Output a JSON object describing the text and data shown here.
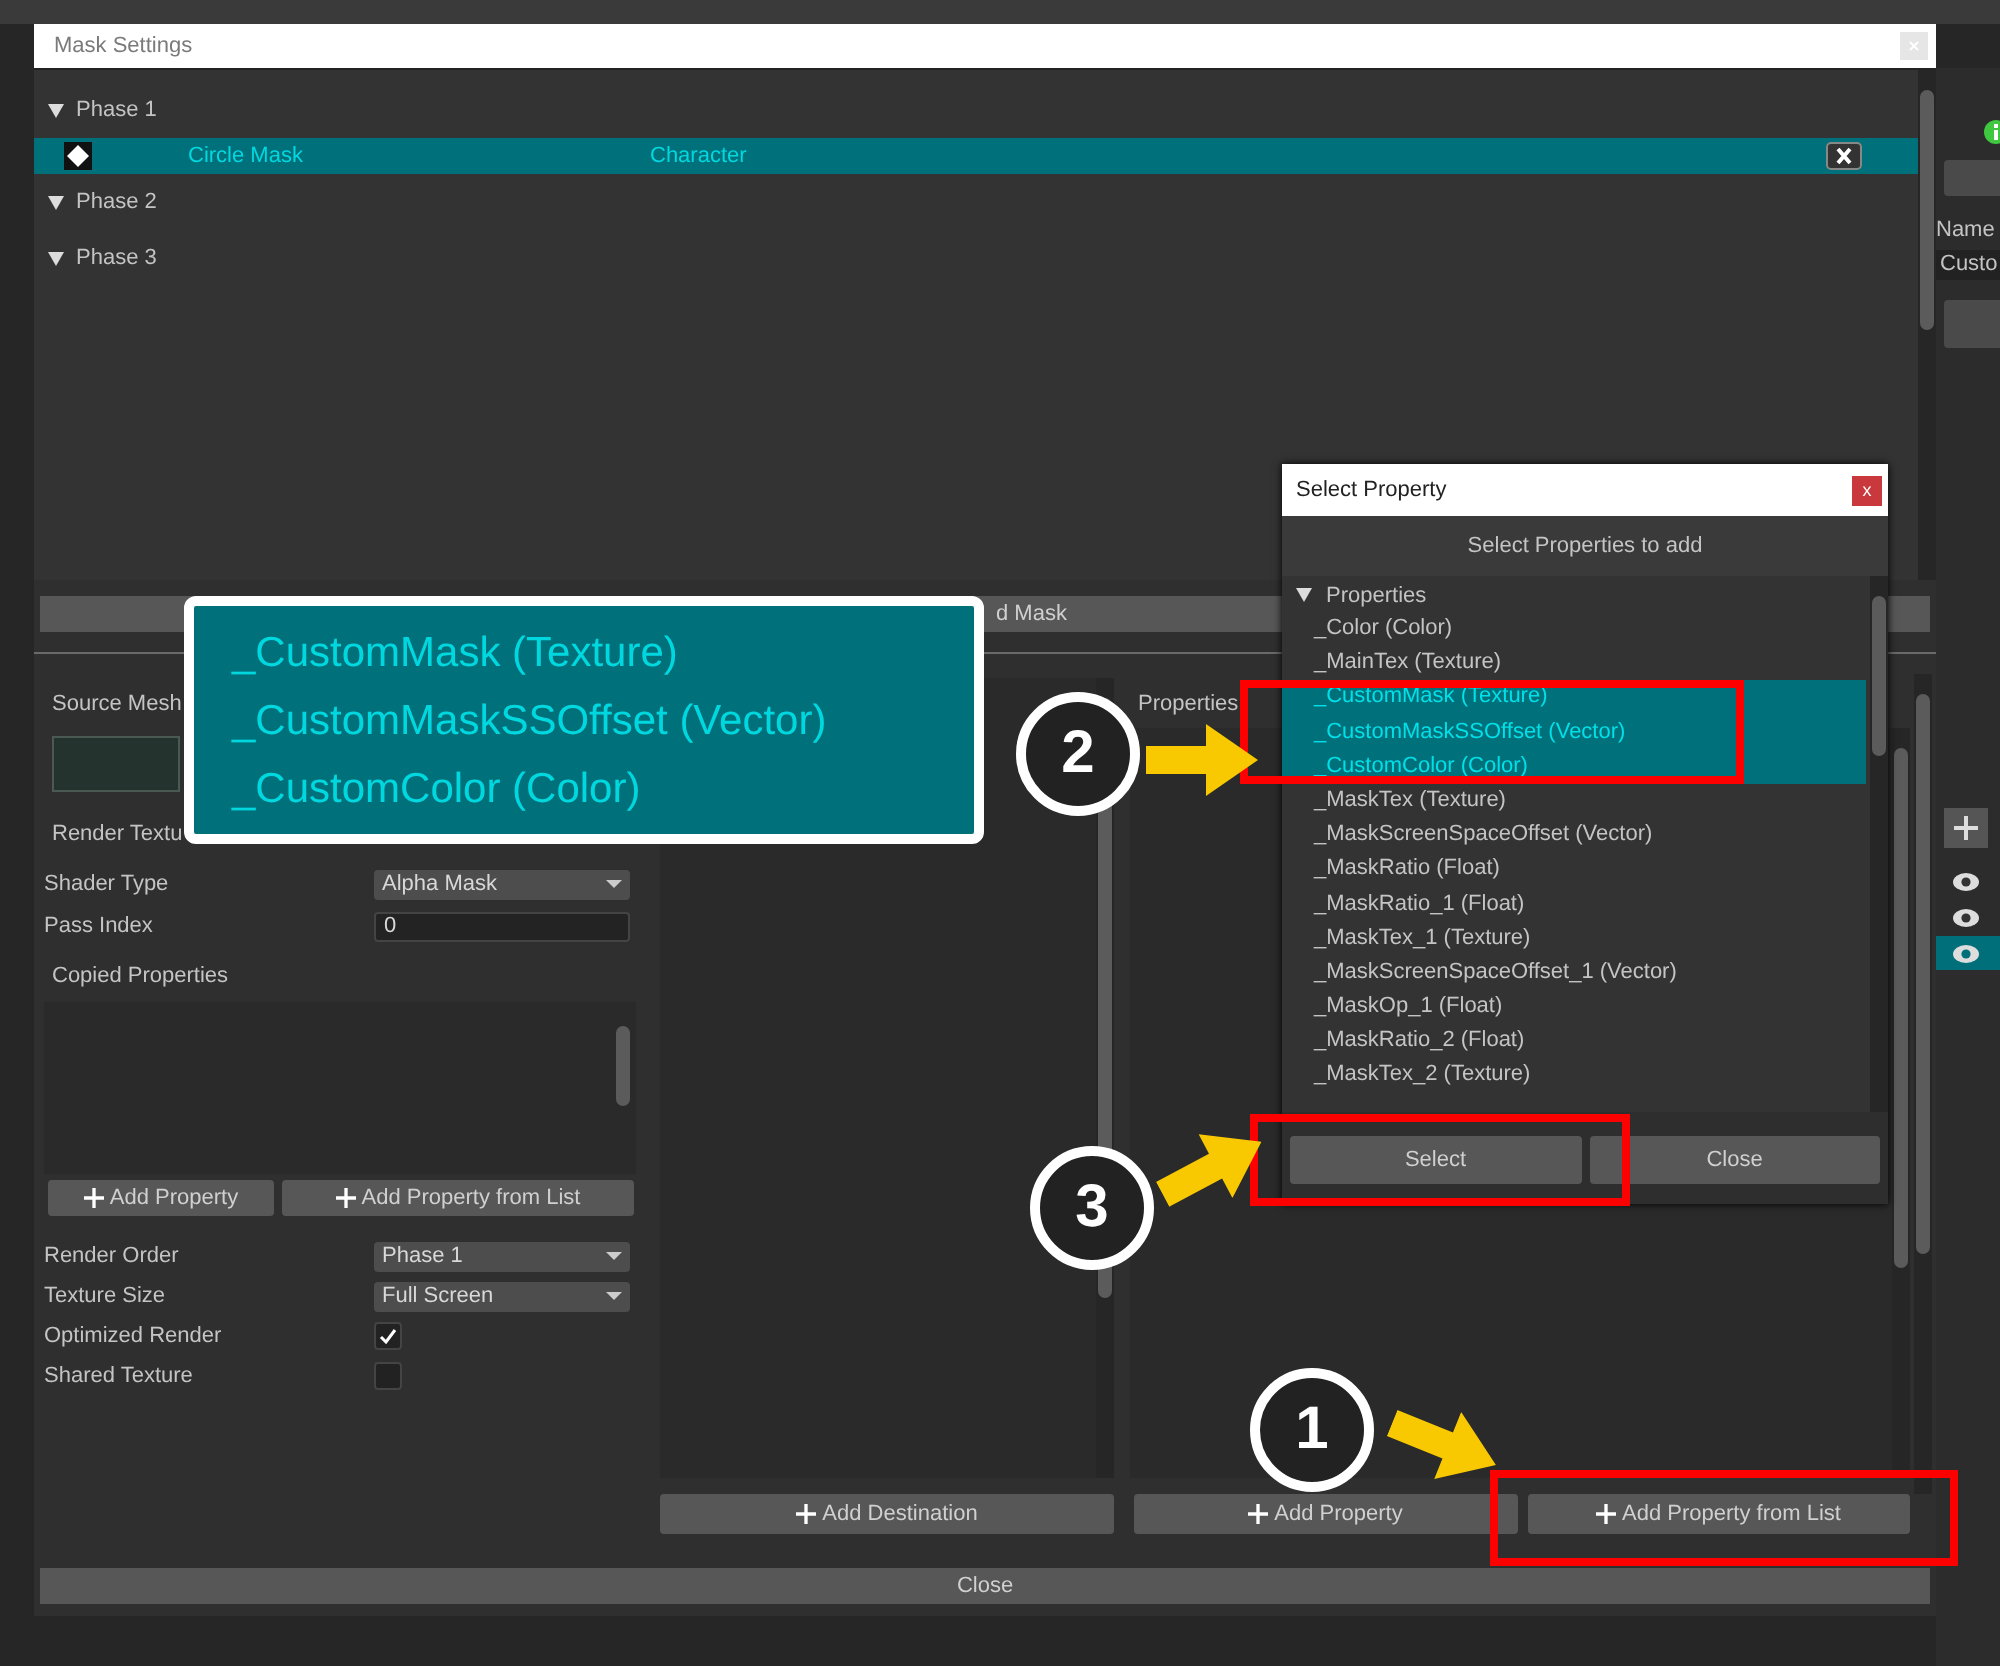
{
  "side_panel": {
    "name_label": "Name",
    "name_value": "Custo"
  },
  "window": {
    "title": "Mask Settings"
  },
  "phases": [
    {
      "label": "Phase 1",
      "expanded": true,
      "items": [
        {
          "name": "Circle Mask",
          "target": "Character",
          "selected": true
        }
      ]
    },
    {
      "label": "Phase 2",
      "expanded": true
    },
    {
      "label": "Phase 3",
      "expanded": true
    }
  ],
  "mask_button": "d Mask",
  "source_mesh_label": "Source Mesh",
  "render_texture_label": "Render Textu",
  "fields": [
    {
      "kind": "dropdown",
      "label": "Shader Type",
      "value": "Alpha Mask"
    },
    {
      "kind": "input",
      "label": "Pass Index",
      "value": "0"
    }
  ],
  "copied_properties": {
    "label": "Copied Properties",
    "buttons": [
      "Add Property",
      "Add Property from List"
    ]
  },
  "settings": [
    {
      "kind": "dropdown",
      "label": "Render Order",
      "value": "Phase 1"
    },
    {
      "kind": "dropdown",
      "label": "Texture Size",
      "value": "Full Screen"
    },
    {
      "kind": "checkbox",
      "label": "Optimized Render",
      "checked": true
    },
    {
      "kind": "checkbox",
      "label": "Shared Texture",
      "checked": false
    }
  ],
  "destination_button": "Add Destination",
  "properties_label": "Properties",
  "property_buttons": [
    "Add Property",
    "Add Property from List"
  ],
  "close_button": "Close",
  "dialog": {
    "title": "Select Property",
    "close": "x",
    "heading": "Select Properties to add",
    "group": "Properties",
    "group_expanded": true,
    "items": [
      {
        "label": "_Color (Color)",
        "selected": false
      },
      {
        "label": "_MainTex (Texture)",
        "selected": false
      },
      {
        "label": "_CustomMask (Texture)",
        "selected": true
      },
      {
        "label": "_CustomMaskSSOffset (Vector)",
        "selected": true
      },
      {
        "label": "_CustomColor (Color)",
        "selected": true
      },
      {
        "label": "_MaskTex (Texture)",
        "selected": false
      },
      {
        "label": "_MaskScreenSpaceOffset (Vector)",
        "selected": false
      },
      {
        "label": "_MaskRatio (Float)",
        "selected": false
      },
      {
        "label": "_MaskRatio_1 (Float)",
        "selected": false
      },
      {
        "label": "_MaskTex_1 (Texture)",
        "selected": false
      },
      {
        "label": "_MaskScreenSpaceOffset_1 (Vector)",
        "selected": false
      },
      {
        "label": "_MaskOp_1 (Float)",
        "selected": false
      },
      {
        "label": "_MaskRatio_2 (Float)",
        "selected": false
      },
      {
        "label": "_MaskTex_2 (Texture)",
        "selected": false
      }
    ],
    "buttons": [
      "Select",
      "Close"
    ]
  },
  "inset": {
    "items": [
      "_CustomMask (Texture)",
      "_CustomMaskSSOffset (Vector)",
      "_CustomColor (Color)"
    ]
  },
  "callouts": [
    {
      "number": "1"
    },
    {
      "number": "2"
    },
    {
      "number": "3"
    }
  ]
}
